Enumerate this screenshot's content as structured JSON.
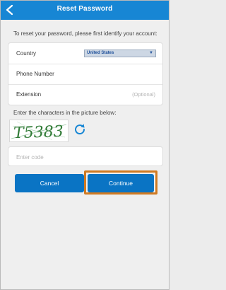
{
  "header": {
    "title": "Reset Password"
  },
  "intro": "To reset your password, please first identify your account:",
  "form": {
    "country_label": "Country",
    "country_value": "United States",
    "phone_label": "Phone Number",
    "extension_label": "Extension",
    "extension_hint": "(Optional)"
  },
  "captcha": {
    "label": "Enter the characters in the picture below:",
    "image_text": "T5383"
  },
  "code": {
    "placeholder": "Enter code"
  },
  "buttons": {
    "cancel": "Cancel",
    "continue": "Continue"
  },
  "colors": {
    "header": "#1786d4",
    "button": "#0a74c4",
    "highlight": "#d07a22",
    "captcha_text": "#2f7a35"
  }
}
